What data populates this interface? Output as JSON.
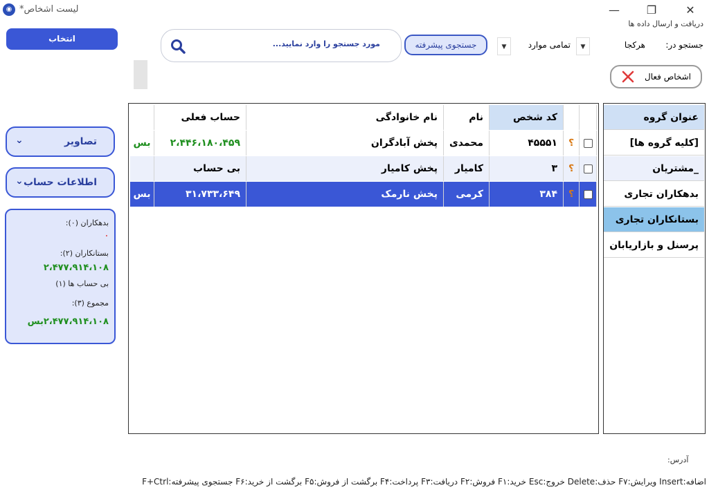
{
  "window": {
    "title": "لیست اشخاص*",
    "minimize_glyph": "—",
    "maximize_glyph": "❐",
    "close_glyph": "✕"
  },
  "header": {
    "sync_link": "دریافت و ارسال داده ها",
    "search_in_label": "جستجو در:",
    "search_scope_value": "هرکجا",
    "filter_value": "تمامی موارد",
    "advanced_search_label": "جستجوی پیشرفته",
    "search_placeholder": "مورد جستجو را وارد نمایید...",
    "select_button": "انتخاب",
    "active_people_label": "اشخاص فعال"
  },
  "groups": {
    "header": "عنوان گروه",
    "items": [
      {
        "label": "[کلیه گروه ها]"
      },
      {
        "label": "_مشتریان"
      },
      {
        "label": "بدهکاران تجاری"
      },
      {
        "label": "بستانکاران تجاری"
      },
      {
        "label": "پرسنل و بازاریابان"
      }
    ]
  },
  "table": {
    "columns": {
      "code": "کد شخص",
      "first_name": "نام",
      "last_name": "نام خانوادگی",
      "balance": "حساب فعلی"
    },
    "rows": [
      {
        "code": "۴۵۵۵۱",
        "first_name": "محمدی",
        "last_name": "پخش آبادگران",
        "balance": "۲،۴۴۶،۱۸۰،۴۵۹",
        "status": "بس",
        "qm": "؟"
      },
      {
        "code": "۳",
        "first_name": "کامیار",
        "last_name": "پخش کامیار",
        "balance": "بی حساب",
        "status": "",
        "qm": "؟"
      },
      {
        "code": "۳۸۴",
        "first_name": "کرمی",
        "last_name": "پخش نارمک",
        "balance": "۳۱،۷۳۳،۶۴۹",
        "status": "بس",
        "qm": "؟"
      }
    ]
  },
  "sidebar": {
    "images_label": "تصاویر",
    "account_info_label": "اطلاعات حساب",
    "summary": {
      "debtors_label": "بدهکاران (۰):",
      "debtors_value": "٠",
      "creditors_label": "بستانکاران (۲):",
      "creditors_value": "۲،۴۷۷،۹۱۴،۱۰۸",
      "no_account_label": "بی حساب ها (۱)",
      "total_label": "مجموع (۳):",
      "total_value": "۲،۴۷۷،۹۱۴،۱۰۸بس"
    }
  },
  "footer": {
    "address_label": "آدرس:",
    "shortcuts": "اضافه:Insert   ویرایش:F۷   حذف:Delete   خروج:Esc   خرید:F۱   فروش:F۲   دریافت:F۳   پرداخت:F۴   برگشت از فروش:F۵   برگشت از خرید:F۶   جستجوی پیشرفته:F+Ctrl"
  },
  "colors": {
    "accent": "#3a57d6",
    "header_highlight": "#cfe0f5",
    "positive": "#1f8f1f",
    "danger": "#e03a3a"
  }
}
